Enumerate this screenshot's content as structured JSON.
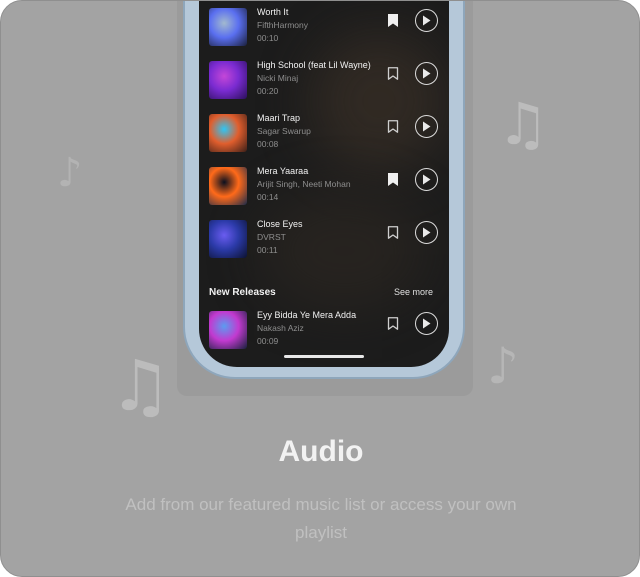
{
  "tracks": [
    {
      "title": "Worth It",
      "artist": "FifthHarmony",
      "duration": "00:10",
      "bookmarked": true,
      "art": [
        "#a2b9cf",
        "#5a6ff0",
        "#1a1f3a"
      ]
    },
    {
      "title": "High School (feat Lil Wayne)",
      "artist": "Nicki Minaj",
      "duration": "00:20",
      "bookmarked": false,
      "art": [
        "#c447d8",
        "#7a2bd1",
        "#2a0f5a"
      ]
    },
    {
      "title": "Maari Trap",
      "artist": "Sagar Swarup",
      "duration": "00:08",
      "bookmarked": false,
      "art": [
        "#2ec6f5",
        "#e15e2d",
        "#3a1f18"
      ]
    },
    {
      "title": "Mera Yaaraa",
      "artist": "Arijit Singh, Neeti Mohan",
      "duration": "00:14",
      "bookmarked": true,
      "art": [
        "#0a0f1e",
        "#ff6a1a",
        "#1a2a4a"
      ]
    },
    {
      "title": "Close Eyes",
      "artist": "DVRST",
      "duration": "00:11",
      "bookmarked": false,
      "art": [
        "#6a5cf0",
        "#2b3aa8",
        "#0c1230"
      ]
    }
  ],
  "new_releases": {
    "title": "New Releases",
    "see_more": "See more",
    "tracks": [
      {
        "title": "Eyy Bidda Ye Mera Adda",
        "artist": "Nakash Aziz",
        "duration": "00:09",
        "bookmarked": false,
        "art": [
          "#5b9cf0",
          "#c23ad0",
          "#16203a"
        ]
      }
    ]
  },
  "hero": {
    "title": "Audio",
    "subtitle": "Add from our featured music list or access your own playlist"
  },
  "icons": {
    "decor": "music-note-icon",
    "bookmark": "bookmark-icon",
    "play": "play-icon"
  },
  "colors": {
    "card_background": "#a3a3a3",
    "screen_background": "#1c1c1c",
    "phone_frame": "#b5c8d9",
    "title_text": "#f2f2f2"
  }
}
